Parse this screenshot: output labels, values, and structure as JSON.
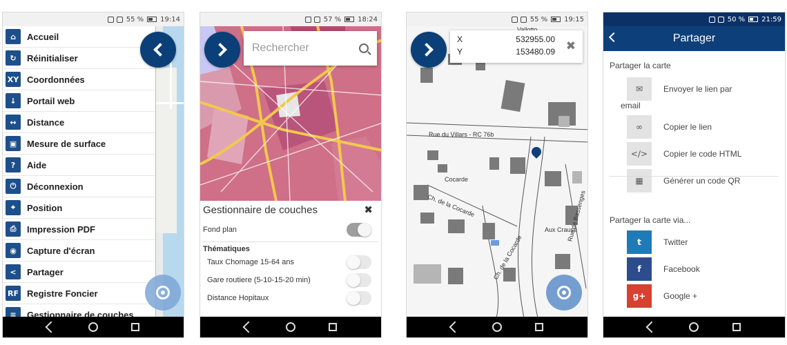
{
  "screens": [
    {
      "status": {
        "pct": "55 %",
        "time": "19:14"
      },
      "menu": [
        {
          "icon": "home-icon",
          "glyph": "⌂",
          "label": "Accueil"
        },
        {
          "icon": "reset-icon",
          "glyph": "↻",
          "label": "Réinitialiser"
        },
        {
          "icon": "coordinates-icon",
          "glyph": "XY",
          "label": "Coordonnées"
        },
        {
          "icon": "web-portal-icon",
          "glyph": "↓",
          "label": "Portail web"
        },
        {
          "icon": "distance-icon",
          "glyph": "↔",
          "label": "Distance"
        },
        {
          "icon": "area-icon",
          "glyph": "▣",
          "label": "Mesure de surface"
        },
        {
          "icon": "help-icon",
          "glyph": "?",
          "label": "Aide"
        },
        {
          "icon": "power-icon",
          "glyph": "⏻",
          "label": "Déconnexion"
        },
        {
          "icon": "position-icon",
          "glyph": "⌖",
          "label": "Position"
        },
        {
          "icon": "printer-icon",
          "glyph": "⎙",
          "label": "Impression PDF"
        },
        {
          "icon": "camera-icon",
          "glyph": "◉",
          "label": "Capture d'écran"
        },
        {
          "icon": "share-icon",
          "glyph": "<",
          "label": "Partager"
        },
        {
          "icon": "land-register-icon",
          "glyph": "RF",
          "label": "Registre Foncier"
        },
        {
          "icon": "layers-icon",
          "glyph": "≡",
          "label": "Gestionnaire de couches"
        }
      ]
    },
    {
      "status": {
        "pct": "57 %",
        "time": "18:24"
      },
      "search_placeholder": "Rechercher",
      "panel_title": "Gestionnaire de couches",
      "base_layer": {
        "label": "Fond plan",
        "on": true
      },
      "thematic_header": "Thématiques",
      "layers": [
        {
          "label": "Taux Chomage 15-64 ans",
          "on": false
        },
        {
          "label": "Gare routiere (5-10-15-20 min)",
          "on": false
        },
        {
          "label": "Distance Hopitaux",
          "on": false
        }
      ]
    },
    {
      "status": {
        "pct": "55 %",
        "time": "19:15"
      },
      "coords": {
        "x_label": "X",
        "x_value": "532955.00",
        "y_label": "Y",
        "y_value": "153480.09"
      },
      "streets": [
        "Rue du Villars - RC 76b",
        "Ch. de la Cocarde",
        "Cocarde",
        "Ch. de la Cocarde",
        "Aux Crause",
        "Rue de Bassenges",
        "Vallotto"
      ]
    },
    {
      "status": {
        "pct": "50 %",
        "time": "21:59"
      },
      "title": "Partager",
      "section1": "Partager la carte",
      "items": [
        {
          "icon": "envelope-icon",
          "glyph": "✉",
          "label": "Envoyer le lien par",
          "label_extra": "email"
        },
        {
          "icon": "link-icon",
          "glyph": "∞",
          "label": "Copier le lien"
        },
        {
          "icon": "code-icon",
          "glyph": "</>",
          "label": "Copier le code HTML"
        },
        {
          "icon": "qr-icon",
          "glyph": "▦",
          "label": "Générer un code QR"
        }
      ],
      "section2": "Partager la carte via...",
      "social": [
        {
          "icon": "twitter-icon",
          "glyph": "t",
          "label": "Twitter",
          "color": "#1f7ab8"
        },
        {
          "icon": "facebook-icon",
          "glyph": "f",
          "label": "Facebook",
          "color": "#2c4c8c"
        },
        {
          "icon": "google-plus-icon",
          "glyph": "g+",
          "label": "Google +",
          "color": "#d8402f"
        }
      ]
    }
  ]
}
